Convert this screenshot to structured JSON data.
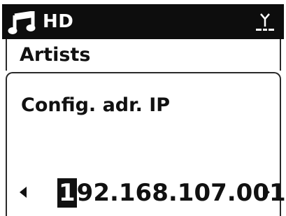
{
  "header": {
    "source_label": "HD",
    "music_icon": "music-note-icon",
    "signal_icon": "antenna-signal-icon"
  },
  "menu": {
    "current_item": "Artists"
  },
  "panel": {
    "title": "Config. adr. IP",
    "ip_cursor_char": "1",
    "ip_rest": "92.168.107.001",
    "left_arrow_icon": "left-arrow-icon",
    "right_arrow_icon": "right-arrow-icon"
  },
  "colors": {
    "header_bg": "#0d0d0d",
    "text": "#111111",
    "background": "#ffffff"
  }
}
